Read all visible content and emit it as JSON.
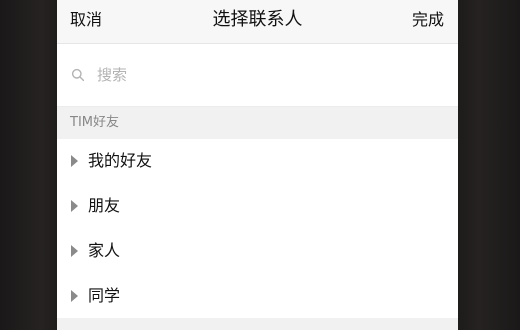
{
  "nav": {
    "cancel_label": "取消",
    "title": "选择联系人",
    "done_label": "完成"
  },
  "search": {
    "placeholder": "搜索",
    "value": ""
  },
  "section": {
    "title": "TIM好友"
  },
  "groups": [
    {
      "label": "我的好友",
      "icon": "caret-right-icon",
      "expanded": false
    },
    {
      "label": "朋友",
      "icon": "caret-right-icon",
      "expanded": false
    },
    {
      "label": "家人",
      "icon": "caret-right-icon",
      "expanded": false
    },
    {
      "label": "同学",
      "icon": "caret-right-icon",
      "expanded": false
    }
  ],
  "colors": {
    "nav_background": "#f7f7f7",
    "section_background": "#f1f1f1",
    "text_primary": "#111111",
    "text_secondary": "#888888",
    "placeholder": "#b3b3b3"
  }
}
